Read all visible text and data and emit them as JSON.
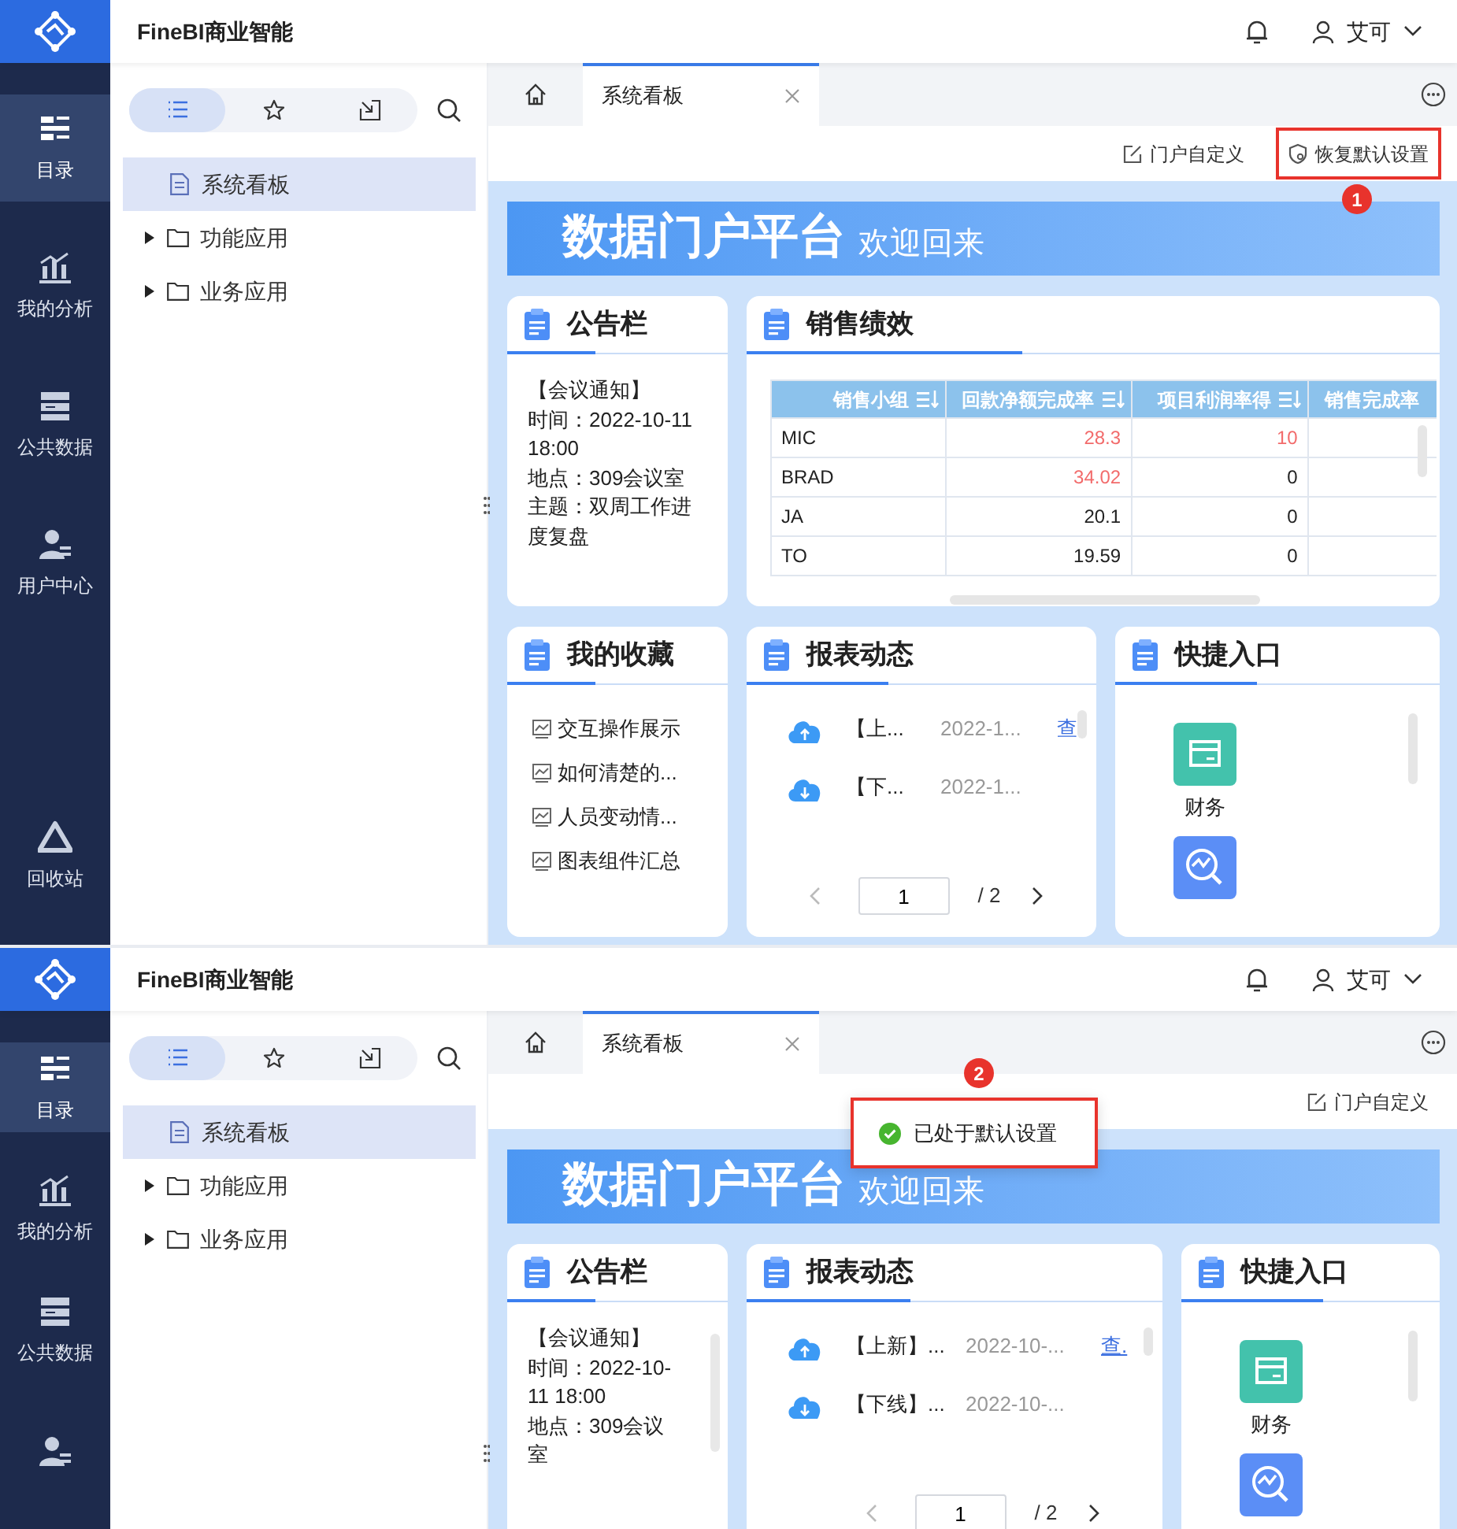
{
  "screens": [
    {
      "app_title": "FineBI商业智能",
      "user": "艾可",
      "nav": [
        {
          "kind": "catalog",
          "label": "目录",
          "selected": true
        },
        {
          "kind": "analysis",
          "label": "我的分析",
          "selected": false
        },
        {
          "kind": "data",
          "label": "公共数据",
          "selected": false
        },
        {
          "kind": "user",
          "label": "用户中心",
          "selected": false
        },
        {
          "kind": "recycle",
          "label": "回收站",
          "selected": false
        }
      ],
      "sidebar_tabs": [
        {
          "kind": "list",
          "selected": true
        },
        {
          "kind": "star",
          "selected": false
        },
        {
          "kind": "import",
          "selected": false
        }
      ],
      "tree": [
        {
          "kind": "file",
          "label": "系统看板",
          "selected": true
        },
        {
          "kind": "folder",
          "label": "功能应用",
          "selected": false
        },
        {
          "kind": "folder",
          "label": "业务应用",
          "selected": false
        }
      ],
      "tabs": [
        {
          "kind": "home",
          "selected": false
        },
        {
          "kind": "page",
          "label": "系统看板",
          "selected": true
        }
      ],
      "toolbar": [
        {
          "kind": "edit",
          "label": "门户自定义"
        },
        {
          "kind": "restore",
          "label": "恢复默认设置",
          "annotation": "1"
        }
      ],
      "banner": {
        "title": "数据门户平台",
        "subtitle": "欢迎回来"
      },
      "widget_rows": [
        [
          {
            "kind": "notice",
            "title": "公告栏",
            "lines": [
              "【会议通知】",
              "时间：2022-10-11",
              "18:00",
              "地点：309会议室",
              "主题：双周工作进",
              "度复盘"
            ]
          },
          {
            "kind": "table",
            "title": "销售绩效",
            "columns": [
              "销售小组",
              "回款净额完成率",
              "项目利润率得",
              "销售完成率"
            ],
            "rows": [
              {
                "group": "MIC",
                "values": [
                  {
                    "text": "28.3",
                    "alert": true
                  },
                  {
                    "text": "10",
                    "alert": true
                  }
                ]
              },
              {
                "group": "BRAD",
                "values": [
                  {
                    "text": "34.02",
                    "alert": true
                  },
                  {
                    "text": "0",
                    "alert": false
                  }
                ]
              },
              {
                "group": "JA",
                "values": [
                  {
                    "text": "20.1",
                    "alert": false
                  },
                  {
                    "text": "0",
                    "alert": false
                  }
                ]
              },
              {
                "group": "TO",
                "values": [
                  {
                    "text": "19.59",
                    "alert": false
                  },
                  {
                    "text": "0",
                    "alert": false
                  }
                ]
              }
            ]
          }
        ],
        [
          {
            "kind": "favorites",
            "title": "我的收藏",
            "items": [
              "交互操作展示",
              "如何清楚的...",
              "人员变动情...",
              "图表组件汇总"
            ]
          },
          {
            "kind": "reports",
            "title": "报表动态",
            "items": [
              {
                "kind": "up",
                "title": "【上...",
                "date": "2022-1...",
                "link": "查"
              },
              {
                "kind": "down",
                "title": "【下...",
                "date": "2022-1..."
              }
            ],
            "page": "1",
            "total": "/ 2"
          },
          {
            "kind": "quick",
            "title": "快捷入口",
            "items": [
              {
                "kind": "finance",
                "label": "财务"
              },
              {
                "kind": "analysis"
              }
            ]
          }
        ]
      ]
    },
    {
      "app_title": "FineBI商业智能",
      "user": "艾可",
      "nav": [
        {
          "kind": "catalog",
          "label": "目录",
          "selected": true
        },
        {
          "kind": "analysis",
          "label": "我的分析",
          "selected": false
        },
        {
          "kind": "data",
          "label": "公共数据",
          "selected": false
        },
        {
          "kind": "user",
          "selected": false
        }
      ],
      "sidebar_tabs": [
        {
          "kind": "list",
          "selected": true
        },
        {
          "kind": "star",
          "selected": false
        },
        {
          "kind": "import",
          "selected": false
        }
      ],
      "tree": [
        {
          "kind": "file",
          "label": "系统看板",
          "selected": true
        },
        {
          "kind": "folder",
          "label": "功能应用",
          "selected": false
        },
        {
          "kind": "folder",
          "label": "业务应用",
          "selected": false
        }
      ],
      "tabs": [
        {
          "kind": "home",
          "selected": false
        },
        {
          "kind": "page",
          "label": "系统看板",
          "selected": true
        }
      ],
      "toolbar": [
        {
          "kind": "edit",
          "label": "门户自定义"
        }
      ],
      "toast": {
        "text": "已处于默认设置",
        "annotation": "2"
      },
      "banner": {
        "title": "数据门户平台",
        "subtitle": "欢迎回来"
      },
      "widget_rows": [
        [
          {
            "kind": "notice",
            "title": "公告栏",
            "lines": [
              "【会议通知】",
              "时间：2022-10-",
              "11 18:00",
              "地点：309会议",
              "室"
            ]
          },
          {
            "kind": "reports",
            "title": "报表动态",
            "items": [
              {
                "kind": "up",
                "title": "【上新】...",
                "date": "2022-10-...",
                "link": "查."
              },
              {
                "kind": "down",
                "title": "【下线】...",
                "date": "2022-10-..."
              }
            ],
            "page": "1",
            "total": "/ 2"
          },
          {
            "kind": "quick",
            "title": "快捷入口",
            "items": [
              {
                "kind": "finance",
                "label": "财务"
              },
              {
                "kind": "analysis"
              }
            ]
          }
        ]
      ]
    }
  ]
}
